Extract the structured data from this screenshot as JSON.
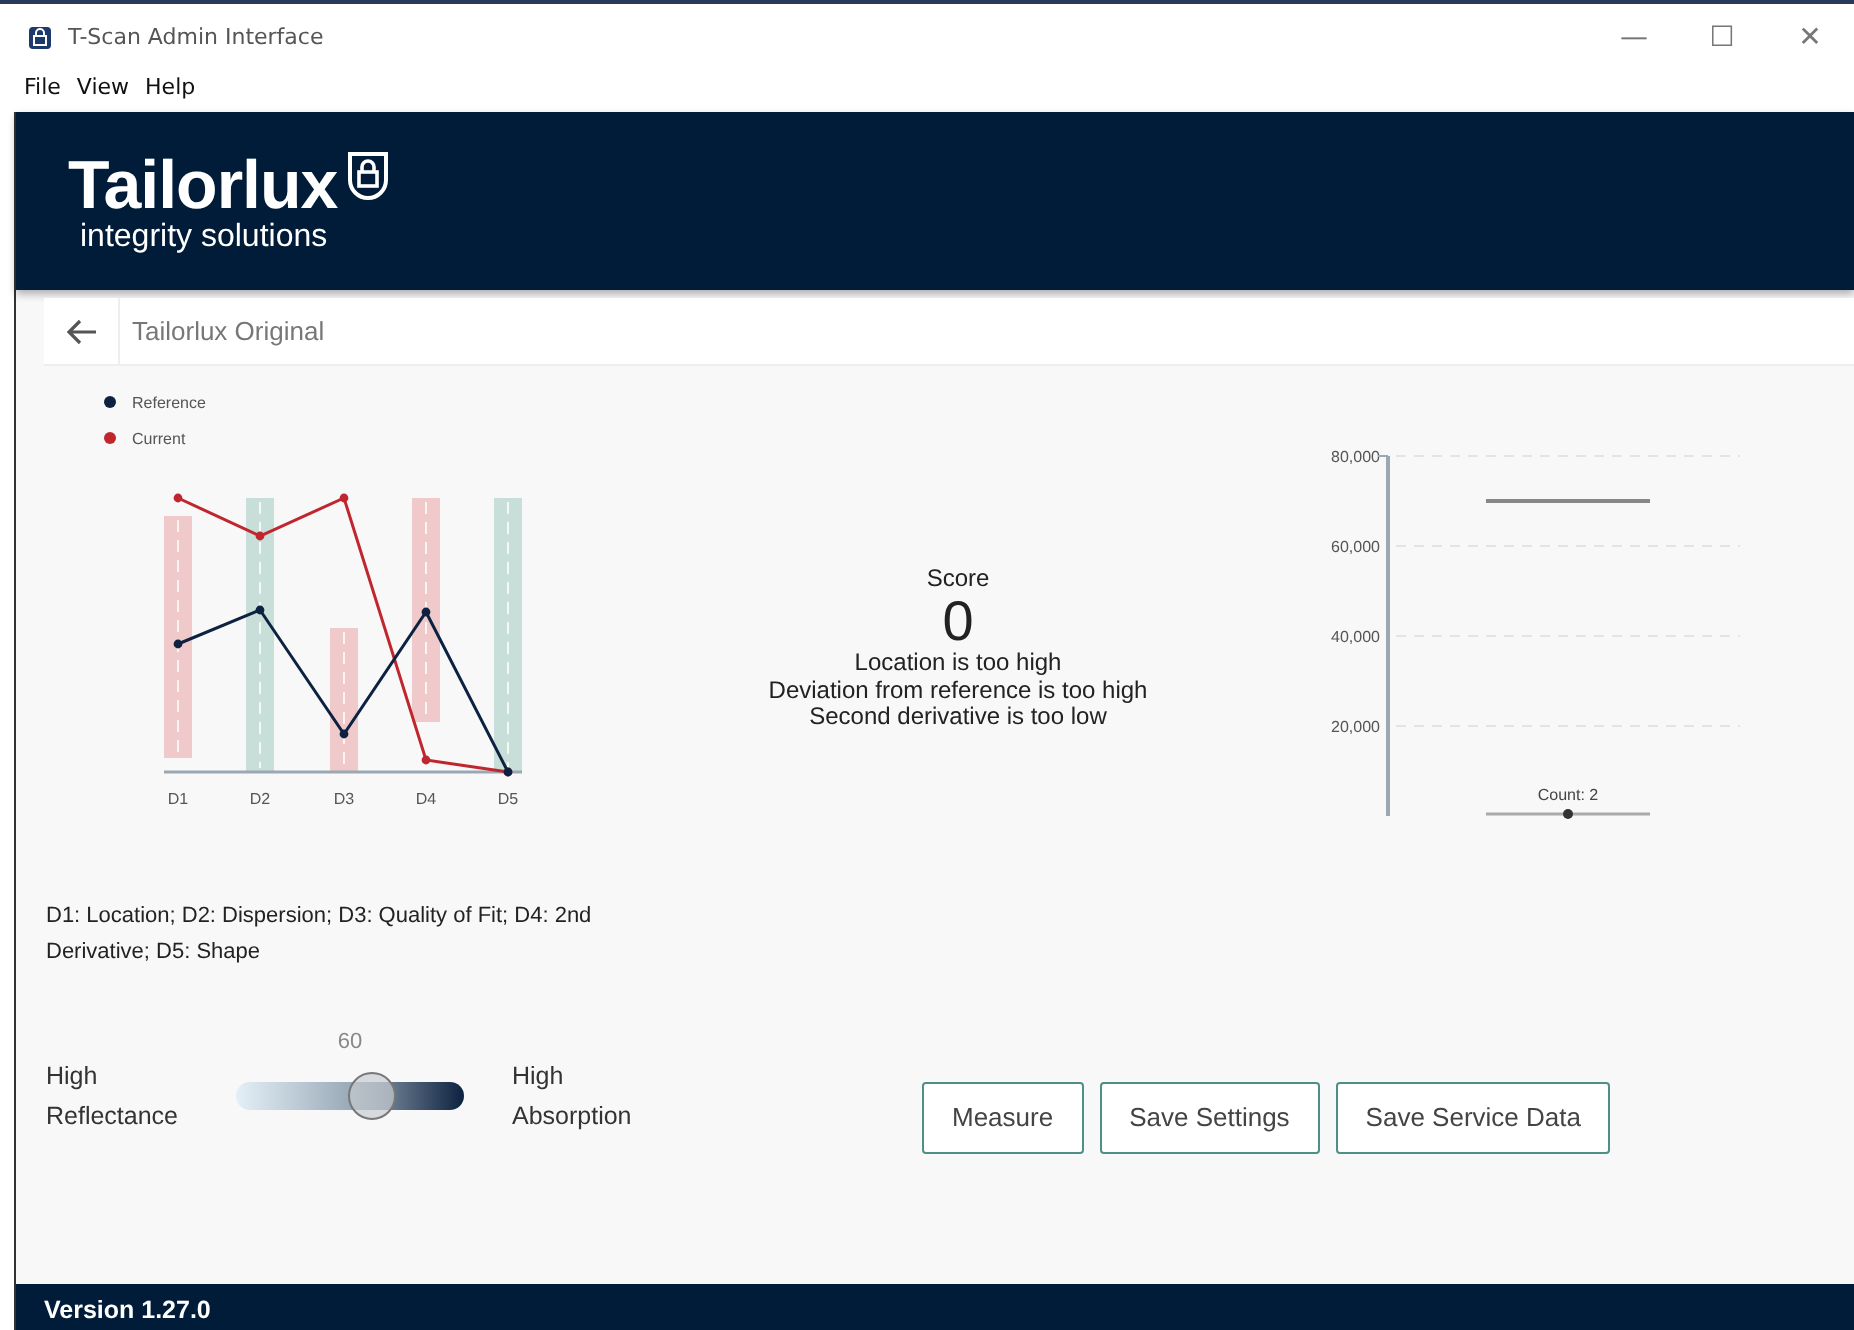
{
  "window": {
    "title": "T-Scan Admin Interface",
    "controls": [
      "—",
      "☐",
      "✕"
    ]
  },
  "menu": [
    "File",
    "View",
    "Help"
  ],
  "brand": {
    "name": "Tailorlux",
    "tagline": "integrity solutions"
  },
  "page": {
    "title": "Tailorlux Original"
  },
  "dimension_chart": {
    "legend": [
      {
        "label": "Reference",
        "color": "#0d2240"
      },
      {
        "label": "Current",
        "color": "#c0262d"
      }
    ],
    "x_labels": [
      "D1",
      "D2",
      "D3",
      "D4",
      "D5"
    ]
  },
  "result": {
    "label": "Score",
    "score": "0",
    "messages": [
      "Location is too high",
      "Deviation from reference is too high",
      "Second derivative is too low"
    ]
  },
  "count_chart": {
    "chart_data": {
      "type": "line",
      "series": [
        {
          "name": "Count: 2",
          "color": "#888888",
          "values": [
            70000,
            70000
          ]
        }
      ],
      "ylim": [
        0,
        80000
      ],
      "yticks": [
        {
          "value": 20000,
          "label": "20,000"
        },
        {
          "value": 40000,
          "label": "40,000"
        },
        {
          "value": 60000,
          "label": "60,000"
        },
        {
          "value": 80000,
          "label": "80,000"
        }
      ],
      "grid": true
    }
  },
  "legend_text": "D1: Location; D2: Dispersion; D3: Quality of Fit; D4: 2nd Derivative; D5: Shape",
  "slider": {
    "left_label": "High Reflectance",
    "right_label": "High Absorption",
    "reading": "60",
    "level": 0.6
  },
  "buttons": [
    "Measure",
    "Save Settings",
    "Save Service Data"
  ],
  "status_bar": {
    "version": "Version 1.27.0"
  }
}
